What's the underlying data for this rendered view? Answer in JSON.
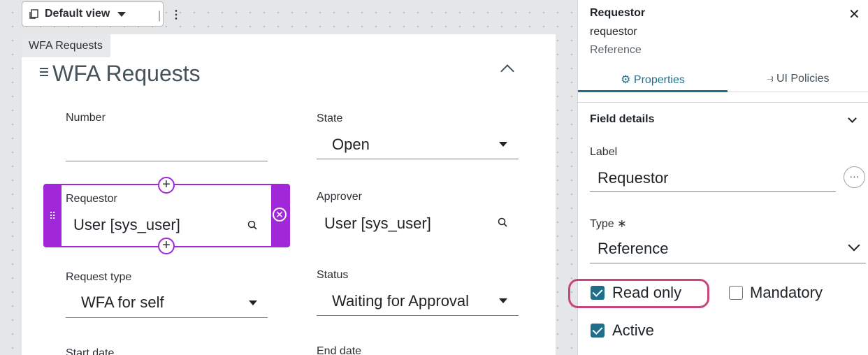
{
  "view_bar": {
    "label": "Default view",
    "separator": "|",
    "menu": "⋮"
  },
  "form": {
    "tab_label": "WFA Requests",
    "section_title": "WFA Requests",
    "fields": {
      "number": {
        "label": "Number",
        "value": ""
      },
      "state": {
        "label": "State",
        "value": "Open"
      },
      "requestor": {
        "label": "Requestor",
        "value": "User [sys_user]"
      },
      "approver": {
        "label": "Approver",
        "value": "User [sys_user]"
      },
      "request_type": {
        "label": "Request type",
        "value": "WFA for self"
      },
      "status": {
        "label": "Status",
        "value": "Waiting for Approval"
      },
      "start_date": {
        "label": "Start date"
      },
      "end_date": {
        "label": "End date"
      }
    },
    "controls": {
      "plus": "+",
      "remove": "✕",
      "grip": "⠿"
    }
  },
  "panel": {
    "title": "Requestor",
    "field_name": "requestor",
    "field_type": "Reference",
    "close": "✕",
    "tabs": [
      {
        "label": "Properties",
        "icon": "gear-icon",
        "active": true
      },
      {
        "label": "UI Policies",
        "icon": "ui-policy-icon",
        "active": false
      }
    ],
    "tab_properties_text": "⚙ Properties",
    "tab_policies_text": "⥽ UI Policies",
    "section": "Field details",
    "label_field": {
      "label": "Label",
      "value": "Requestor",
      "more": "···"
    },
    "type_field": {
      "label": "Type ∗",
      "value": "Reference"
    },
    "checkboxes": {
      "read_only": {
        "label": "Read only",
        "checked": true
      },
      "mandatory": {
        "label": "Mandatory",
        "checked": false
      },
      "active": {
        "label": "Active",
        "checked": true
      }
    }
  },
  "colors": {
    "accent": "#1f6f8b",
    "selection": "#a128d8",
    "highlight": "#c7467a"
  }
}
